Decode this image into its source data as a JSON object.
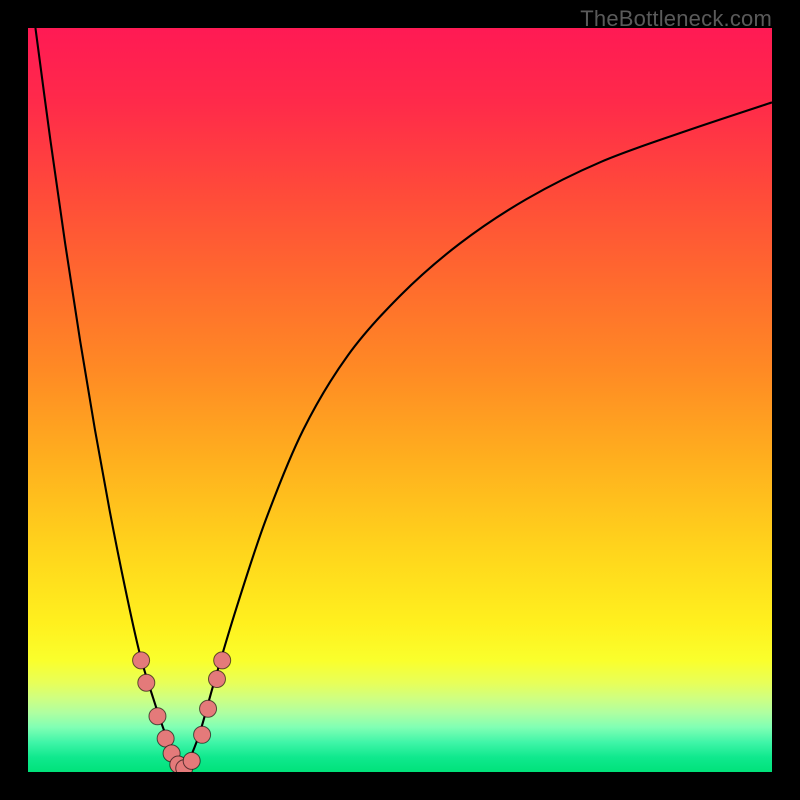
{
  "watermark": "TheBottleneck.com",
  "colors": {
    "top": "#ff1a54",
    "mid": "#ffd41c",
    "bottom": "#00e27a",
    "curve": "#000000",
    "bead": "#e47a7a",
    "frame": "#000000"
  },
  "chart_data": {
    "type": "line",
    "title": "",
    "xlabel": "",
    "ylabel": "",
    "xlim": [
      0,
      100
    ],
    "ylim": [
      0,
      100
    ],
    "note": "background gradient maps y→color (low green / high red); no axes, ticks, or labels visible",
    "series": [
      {
        "name": "left-branch",
        "x": [
          1,
          3,
          5,
          7,
          9,
          11,
          13,
          15,
          16.8,
          18.5,
          20,
          21
        ],
        "y": [
          100,
          85,
          71,
          58,
          46,
          35,
          25,
          16,
          10,
          5,
          1.5,
          0
        ]
      },
      {
        "name": "right-branch",
        "x": [
          21,
          23,
          25,
          28,
          32,
          37,
          43,
          50,
          58,
          67,
          77,
          88,
          100
        ],
        "y": [
          0,
          5,
          12,
          22,
          34,
          46,
          56,
          64,
          71,
          77,
          82,
          86,
          90
        ]
      }
    ],
    "markers": [
      {
        "branch": "left",
        "x": 15.2,
        "y": 15.0
      },
      {
        "branch": "left",
        "x": 15.9,
        "y": 12.0
      },
      {
        "branch": "left",
        "x": 17.4,
        "y": 7.5
      },
      {
        "branch": "left",
        "x": 18.5,
        "y": 4.5
      },
      {
        "branch": "left",
        "x": 19.3,
        "y": 2.5
      },
      {
        "branch": "left",
        "x": 20.2,
        "y": 1.0
      },
      {
        "branch": "valley",
        "x": 21.0,
        "y": 0.5
      },
      {
        "branch": "right",
        "x": 22.0,
        "y": 1.5
      },
      {
        "branch": "right",
        "x": 23.4,
        "y": 5.0
      },
      {
        "branch": "right",
        "x": 24.2,
        "y": 8.5
      },
      {
        "branch": "right",
        "x": 25.4,
        "y": 12.5
      },
      {
        "branch": "right",
        "x": 26.1,
        "y": 15.0
      }
    ]
  }
}
